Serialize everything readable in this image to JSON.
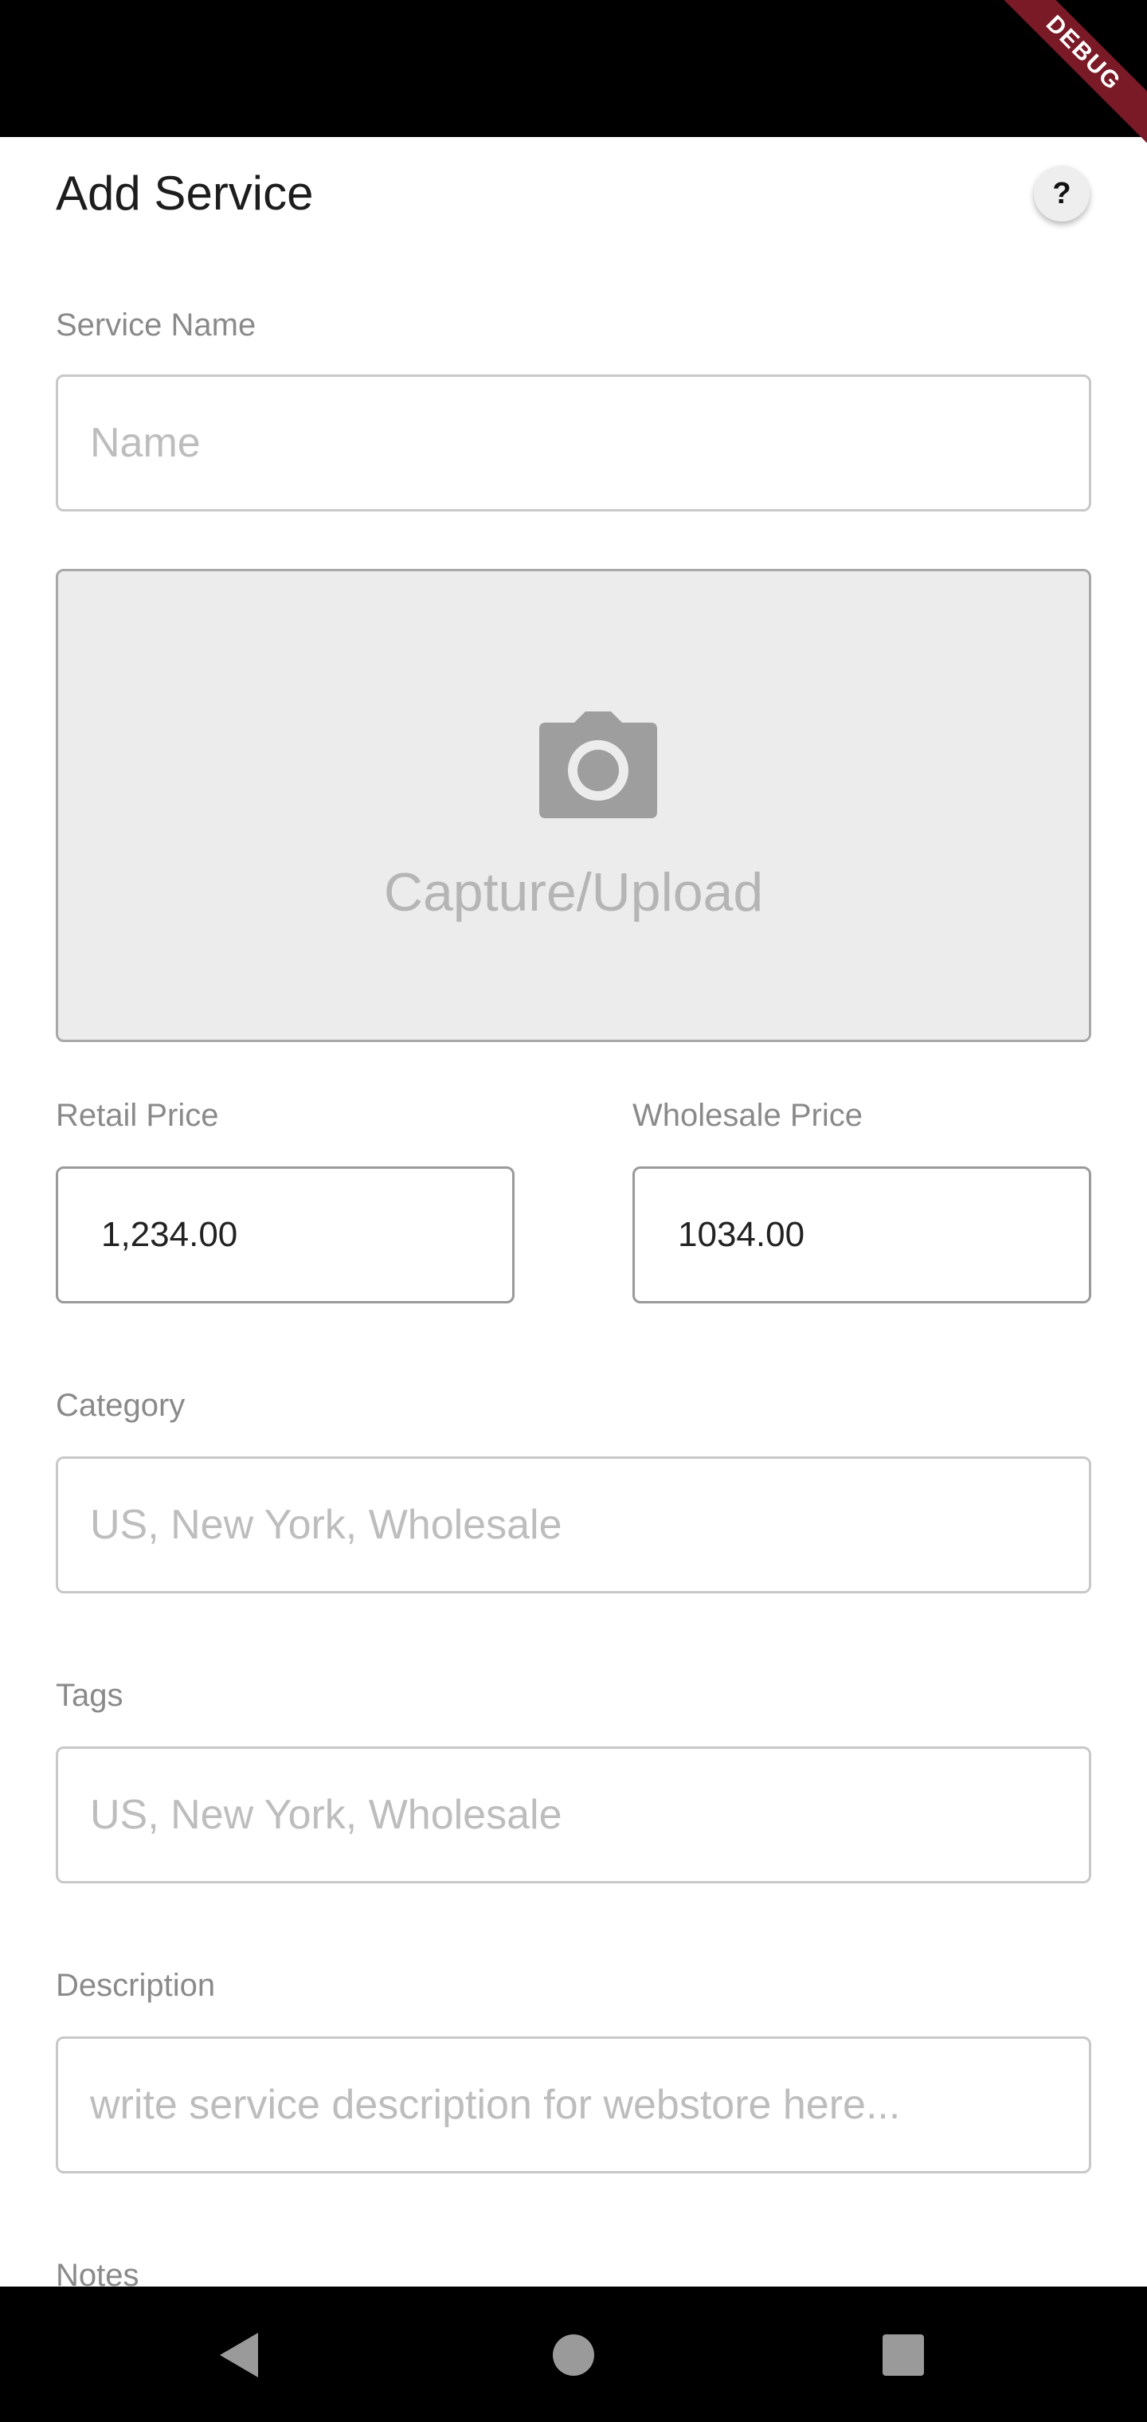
{
  "debug_banner": "DEBUG",
  "app_bar": {
    "title": "Add Service",
    "help_label": "?"
  },
  "form": {
    "service_name": {
      "label": "Service Name",
      "placeholder": "Name"
    },
    "image_upload": {
      "label": "Capture/Upload",
      "icon": "camera-icon"
    },
    "retail_price": {
      "label": "Retail Price",
      "value": "1,234.00"
    },
    "wholesale_price": {
      "label": "Wholesale Price",
      "value": "1034.00"
    },
    "category": {
      "label": "Category",
      "placeholder": "US, New York, Wholesale"
    },
    "tags": {
      "label": "Tags",
      "placeholder": "US, New York, Wholesale"
    },
    "description": {
      "label": "Description",
      "placeholder": "write service description for webstore here..."
    },
    "notes": {
      "label": "Notes"
    }
  },
  "nav_bar": {
    "icons": [
      "back-icon",
      "home-icon",
      "recents-icon"
    ]
  }
}
